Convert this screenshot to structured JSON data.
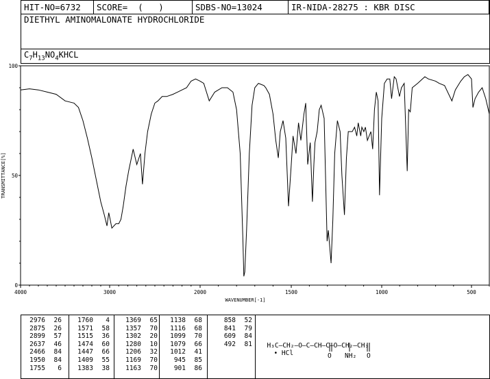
{
  "header": {
    "hit_no": "HIT-NO=6732",
    "score": "SCORE=  (   )",
    "sdbs_no": "SDBS-NO=13024",
    "ir_code": "IR-NIDA-28275 : KBR DISC"
  },
  "compound_name": "DIETHYL AMINOMALONATE HYDROCHLORIDE",
  "formula": {
    "c": "C",
    "c_sub": "7",
    "h": "H",
    "h_sub": "13",
    "n": "NO",
    "o_sub": "4",
    "tail": "KHCL"
  },
  "chart_data": {
    "type": "line",
    "xlabel": "WAVENUMBER[-1]",
    "ylabel": "TRANSMITTANCE[%]",
    "xlim": [
      4000,
      400
    ],
    "ylim": [
      0,
      100
    ],
    "x_ticks": [
      "4000",
      "3000",
      "2000",
      "1500",
      "1000",
      "500"
    ],
    "y_ticks": [
      "100",
      "50",
      "0"
    ],
    "spectrum": [
      [
        4000,
        89
      ],
      [
        3900,
        89.5
      ],
      [
        3800,
        89
      ],
      [
        3700,
        88
      ],
      [
        3600,
        87
      ],
      [
        3500,
        84
      ],
      [
        3450,
        83.5
      ],
      [
        3400,
        83
      ],
      [
        3350,
        81
      ],
      [
        3300,
        75
      ],
      [
        3250,
        67
      ],
      [
        3200,
        58
      ],
      [
        3150,
        48
      ],
      [
        3100,
        38
      ],
      [
        3060,
        32
      ],
      [
        3030,
        27
      ],
      [
        3010,
        33
      ],
      [
        2995,
        30
      ],
      [
        2976,
        26
      ],
      [
        2930,
        28
      ],
      [
        2899,
        28
      ],
      [
        2875,
        30
      ],
      [
        2850,
        36
      ],
      [
        2820,
        45
      ],
      [
        2790,
        52
      ],
      [
        2760,
        58
      ],
      [
        2740,
        62
      ],
      [
        2700,
        55
      ],
      [
        2660,
        60
      ],
      [
        2637,
        46
      ],
      [
        2610,
        60
      ],
      [
        2580,
        70
      ],
      [
        2540,
        78
      ],
      [
        2500,
        83
      ],
      [
        2466,
        84
      ],
      [
        2420,
        86
      ],
      [
        2370,
        86
      ],
      [
        2300,
        87
      ],
      [
        2250,
        88
      ],
      [
        2200,
        89
      ],
      [
        2150,
        90
      ],
      [
        2100,
        93
      ],
      [
        2050,
        94
      ],
      [
        2000,
        93
      ],
      [
        1980,
        92
      ],
      [
        1950,
        84
      ],
      [
        1920,
        88
      ],
      [
        1880,
        90
      ],
      [
        1850,
        90
      ],
      [
        1820,
        88
      ],
      [
        1800,
        80
      ],
      [
        1780,
        60
      ],
      [
        1765,
        20
      ],
      [
        1760,
        4
      ],
      [
        1755,
        6
      ],
      [
        1745,
        25
      ],
      [
        1730,
        60
      ],
      [
        1715,
        82
      ],
      [
        1700,
        90
      ],
      [
        1680,
        92
      ],
      [
        1650,
        91
      ],
      [
        1640,
        90
      ],
      [
        1620,
        87
      ],
      [
        1600,
        78
      ],
      [
        1585,
        66
      ],
      [
        1571,
        58
      ],
      [
        1560,
        70
      ],
      [
        1545,
        75
      ],
      [
        1530,
        67
      ],
      [
        1515,
        36
      ],
      [
        1500,
        55
      ],
      [
        1490,
        68
      ],
      [
        1474,
        60
      ],
      [
        1460,
        74
      ],
      [
        1447,
        66
      ],
      [
        1430,
        78
      ],
      [
        1420,
        83
      ],
      [
        1409,
        55
      ],
      [
        1395,
        65
      ],
      [
        1383,
        38
      ],
      [
        1375,
        55
      ],
      [
        1369,
        65
      ],
      [
        1357,
        70
      ],
      [
        1345,
        80
      ],
      [
        1335,
        82
      ],
      [
        1318,
        76
      ],
      [
        1302,
        20
      ],
      [
        1295,
        25
      ],
      [
        1280,
        10
      ],
      [
        1270,
        30
      ],
      [
        1260,
        60
      ],
      [
        1245,
        75
      ],
      [
        1230,
        70
      ],
      [
        1220,
        50
      ],
      [
        1206,
        32
      ],
      [
        1195,
        58
      ],
      [
        1185,
        70
      ],
      [
        1169,
        70
      ],
      [
        1163,
        70
      ],
      [
        1150,
        72
      ],
      [
        1138,
        68
      ],
      [
        1130,
        74
      ],
      [
        1116,
        68
      ],
      [
        1110,
        72
      ],
      [
        1099,
        70
      ],
      [
        1090,
        72
      ],
      [
        1079,
        66
      ],
      [
        1060,
        70
      ],
      [
        1050,
        62
      ],
      [
        1040,
        80
      ],
      [
        1030,
        88
      ],
      [
        1020,
        84
      ],
      [
        1012,
        41
      ],
      [
        1000,
        76
      ],
      [
        985,
        92
      ],
      [
        970,
        94
      ],
      [
        955,
        94
      ],
      [
        945,
        85
      ],
      [
        930,
        95
      ],
      [
        920,
        94
      ],
      [
        901,
        86
      ],
      [
        890,
        90
      ],
      [
        875,
        92
      ],
      [
        858,
        52
      ],
      [
        850,
        80
      ],
      [
        841,
        79
      ],
      [
        830,
        90
      ],
      [
        800,
        92
      ],
      [
        760,
        95
      ],
      [
        740,
        94
      ],
      [
        700,
        93
      ],
      [
        680,
        92
      ],
      [
        650,
        91
      ],
      [
        609,
        84
      ],
      [
        590,
        89
      ],
      [
        560,
        93
      ],
      [
        540,
        95
      ],
      [
        520,
        96
      ],
      [
        500,
        94
      ],
      [
        492,
        81
      ],
      [
        480,
        85
      ],
      [
        460,
        88
      ],
      [
        440,
        90
      ],
      [
        420,
        85
      ],
      [
        400,
        78
      ]
    ],
    "peak_table": [
      [
        [
          "2976",
          "26"
        ],
        [
          "2875",
          "26"
        ],
        [
          "2899",
          "57"
        ],
        [
          "2637",
          "46"
        ],
        [
          "2466",
          "84"
        ],
        [
          "1950",
          "84"
        ],
        [
          "1755",
          "6"
        ]
      ],
      [
        [
          "1760",
          "4"
        ],
        [
          "1571",
          "58"
        ],
        [
          "1515",
          "36"
        ],
        [
          "1474",
          "60"
        ],
        [
          "1447",
          "66"
        ],
        [
          "1409",
          "55"
        ],
        [
          "1383",
          "38"
        ]
      ],
      [
        [
          "1369",
          "65"
        ],
        [
          "1357",
          "70"
        ],
        [
          "1302",
          "20"
        ],
        [
          "1280",
          "10"
        ],
        [
          "1206",
          "32"
        ],
        [
          "1169",
          "70"
        ],
        [
          "1163",
          "70"
        ]
      ],
      [
        [
          "1138",
          "68"
        ],
        [
          "1116",
          "68"
        ],
        [
          "1099",
          "70"
        ],
        [
          "1079",
          "66"
        ],
        [
          "1012",
          "41"
        ],
        [
          "945",
          "85"
        ],
        [
          "901",
          "86"
        ]
      ],
      [
        [
          "858",
          "52"
        ],
        [
          "841",
          "79"
        ],
        [
          "609",
          "84"
        ],
        [
          "492",
          "81"
        ]
      ]
    ]
  },
  "structure": {
    "main": "H₃C—CH₂—O—C—CH—C—O—CH₂—CH₃",
    "hcl": "• HCl",
    "o1": "O",
    "o2": "O",
    "nh2": "NH₂"
  }
}
